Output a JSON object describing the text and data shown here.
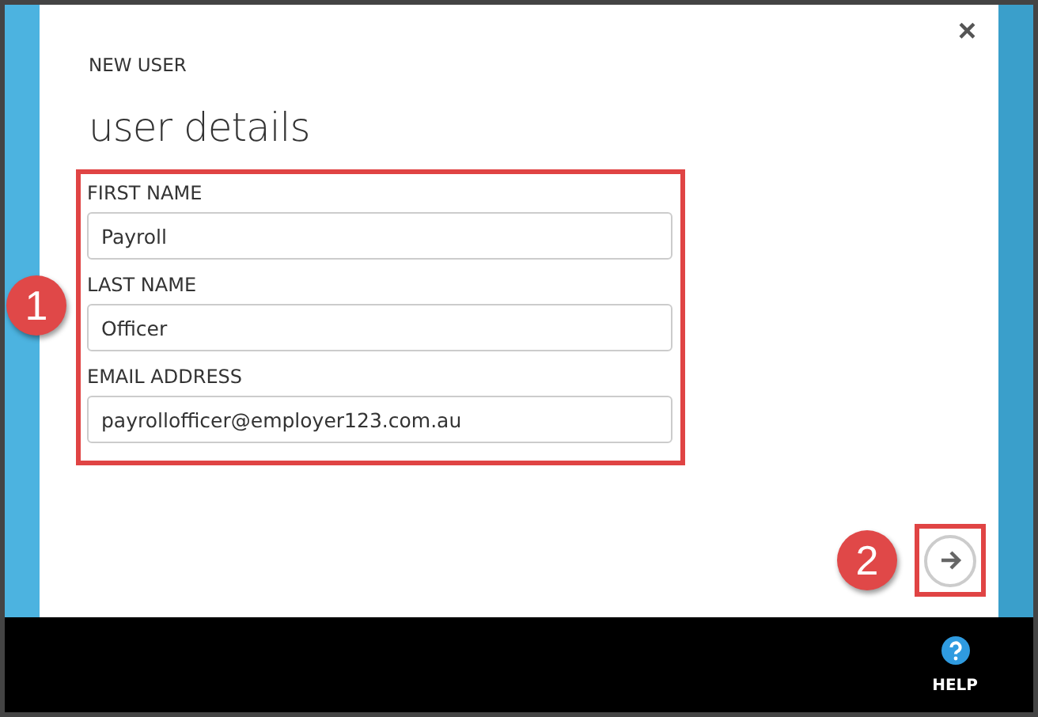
{
  "dialog": {
    "overline": "NEW USER",
    "title": "user details",
    "close": "×",
    "fields": [
      {
        "label": "FIRST NAME",
        "value": "Payroll"
      },
      {
        "label": "LAST NAME",
        "value": "Officer"
      },
      {
        "label": "EMAIL ADDRESS",
        "value": "payrollofficer@employer123.com.au"
      }
    ]
  },
  "callouts": [
    "1",
    "2"
  ],
  "footer": {
    "help": "HELP"
  }
}
